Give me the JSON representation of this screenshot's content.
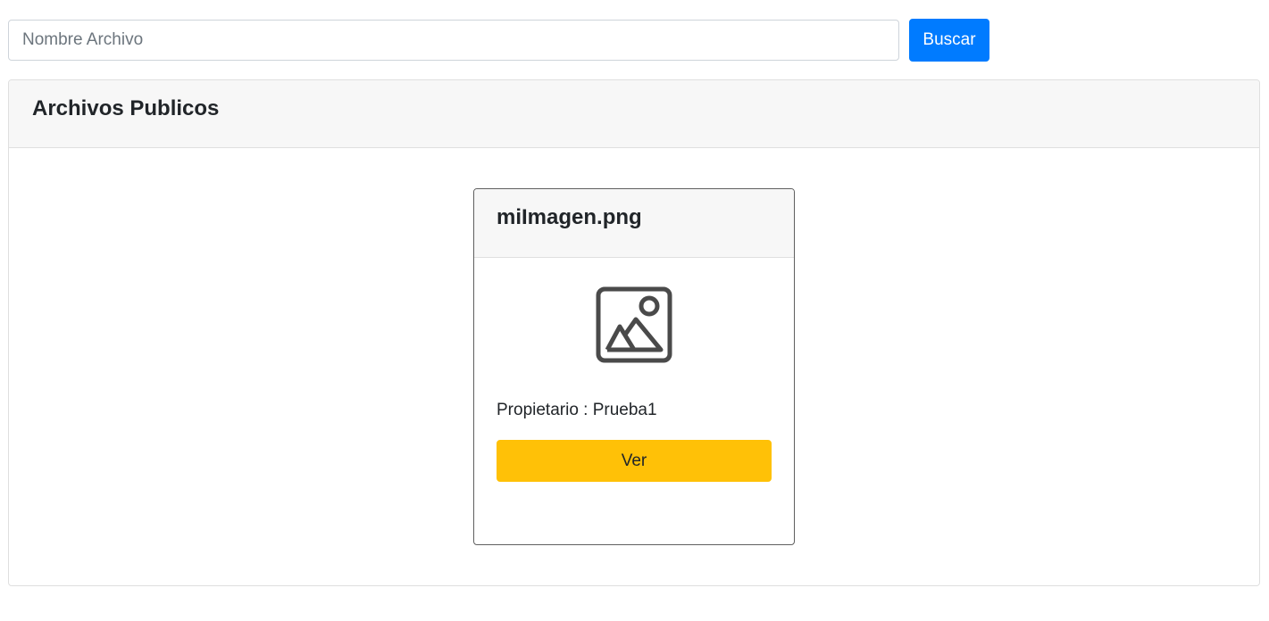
{
  "search": {
    "placeholder": "Nombre Archivo",
    "value": "",
    "button_label": "Buscar"
  },
  "panel": {
    "title": "Archivos Publicos"
  },
  "files": [
    {
      "name": "miImagen.png",
      "icon": "image-icon",
      "owner_label": "Propietario",
      "owner_separator": " : ",
      "owner_name": "Prueba1",
      "view_label": "Ver"
    }
  ],
  "colors": {
    "primary": "#007bff",
    "warning": "#ffc107",
    "header_bg": "#f7f7f7",
    "icon": "#4a4a4a"
  }
}
